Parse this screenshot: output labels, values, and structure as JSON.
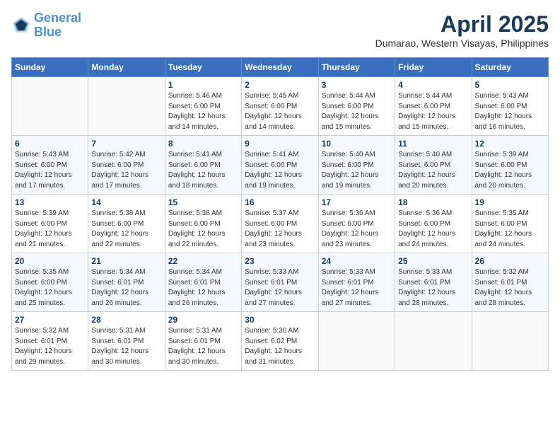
{
  "header": {
    "logo_line1": "General",
    "logo_line2": "Blue",
    "month": "April 2025",
    "location": "Dumarao, Western Visayas, Philippines"
  },
  "weekdays": [
    "Sunday",
    "Monday",
    "Tuesday",
    "Wednesday",
    "Thursday",
    "Friday",
    "Saturday"
  ],
  "weeks": [
    [
      {
        "day": "",
        "info": ""
      },
      {
        "day": "",
        "info": ""
      },
      {
        "day": "1",
        "info": "Sunrise: 5:46 AM\nSunset: 6:00 PM\nDaylight: 12 hours\nand 14 minutes."
      },
      {
        "day": "2",
        "info": "Sunrise: 5:45 AM\nSunset: 6:00 PM\nDaylight: 12 hours\nand 14 minutes."
      },
      {
        "day": "3",
        "info": "Sunrise: 5:44 AM\nSunset: 6:00 PM\nDaylight: 12 hours\nand 15 minutes."
      },
      {
        "day": "4",
        "info": "Sunrise: 5:44 AM\nSunset: 6:00 PM\nDaylight: 12 hours\nand 15 minutes."
      },
      {
        "day": "5",
        "info": "Sunrise: 5:43 AM\nSunset: 6:00 PM\nDaylight: 12 hours\nand 16 minutes."
      }
    ],
    [
      {
        "day": "6",
        "info": "Sunrise: 5:43 AM\nSunset: 6:00 PM\nDaylight: 12 hours\nand 17 minutes."
      },
      {
        "day": "7",
        "info": "Sunrise: 5:42 AM\nSunset: 6:00 PM\nDaylight: 12 hours\nand 17 minutes."
      },
      {
        "day": "8",
        "info": "Sunrise: 5:41 AM\nSunset: 6:00 PM\nDaylight: 12 hours\nand 18 minutes."
      },
      {
        "day": "9",
        "info": "Sunrise: 5:41 AM\nSunset: 6:00 PM\nDaylight: 12 hours\nand 19 minutes."
      },
      {
        "day": "10",
        "info": "Sunrise: 5:40 AM\nSunset: 6:00 PM\nDaylight: 12 hours\nand 19 minutes."
      },
      {
        "day": "11",
        "info": "Sunrise: 5:40 AM\nSunset: 6:00 PM\nDaylight: 12 hours\nand 20 minutes."
      },
      {
        "day": "12",
        "info": "Sunrise: 5:39 AM\nSunset: 6:00 PM\nDaylight: 12 hours\nand 20 minutes."
      }
    ],
    [
      {
        "day": "13",
        "info": "Sunrise: 5:39 AM\nSunset: 6:00 PM\nDaylight: 12 hours\nand 21 minutes."
      },
      {
        "day": "14",
        "info": "Sunrise: 5:38 AM\nSunset: 6:00 PM\nDaylight: 12 hours\nand 22 minutes."
      },
      {
        "day": "15",
        "info": "Sunrise: 5:38 AM\nSunset: 6:00 PM\nDaylight: 12 hours\nand 22 minutes."
      },
      {
        "day": "16",
        "info": "Sunrise: 5:37 AM\nSunset: 6:00 PM\nDaylight: 12 hours\nand 23 minutes."
      },
      {
        "day": "17",
        "info": "Sunrise: 5:36 AM\nSunset: 6:00 PM\nDaylight: 12 hours\nand 23 minutes."
      },
      {
        "day": "18",
        "info": "Sunrise: 5:36 AM\nSunset: 6:00 PM\nDaylight: 12 hours\nand 24 minutes."
      },
      {
        "day": "19",
        "info": "Sunrise: 5:35 AM\nSunset: 6:00 PM\nDaylight: 12 hours\nand 24 minutes."
      }
    ],
    [
      {
        "day": "20",
        "info": "Sunrise: 5:35 AM\nSunset: 6:00 PM\nDaylight: 12 hours\nand 25 minutes."
      },
      {
        "day": "21",
        "info": "Sunrise: 5:34 AM\nSunset: 6:01 PM\nDaylight: 12 hours\nand 26 minutes."
      },
      {
        "day": "22",
        "info": "Sunrise: 5:34 AM\nSunset: 6:01 PM\nDaylight: 12 hours\nand 26 minutes."
      },
      {
        "day": "23",
        "info": "Sunrise: 5:33 AM\nSunset: 6:01 PM\nDaylight: 12 hours\nand 27 minutes."
      },
      {
        "day": "24",
        "info": "Sunrise: 5:33 AM\nSunset: 6:01 PM\nDaylight: 12 hours\nand 27 minutes."
      },
      {
        "day": "25",
        "info": "Sunrise: 5:33 AM\nSunset: 6:01 PM\nDaylight: 12 hours\nand 28 minutes."
      },
      {
        "day": "26",
        "info": "Sunrise: 5:32 AM\nSunset: 6:01 PM\nDaylight: 12 hours\nand 28 minutes."
      }
    ],
    [
      {
        "day": "27",
        "info": "Sunrise: 5:32 AM\nSunset: 6:01 PM\nDaylight: 12 hours\nand 29 minutes."
      },
      {
        "day": "28",
        "info": "Sunrise: 5:31 AM\nSunset: 6:01 PM\nDaylight: 12 hours\nand 30 minutes."
      },
      {
        "day": "29",
        "info": "Sunrise: 5:31 AM\nSunset: 6:01 PM\nDaylight: 12 hours\nand 30 minutes."
      },
      {
        "day": "30",
        "info": "Sunrise: 5:30 AM\nSunset: 6:02 PM\nDaylight: 12 hours\nand 31 minutes."
      },
      {
        "day": "",
        "info": ""
      },
      {
        "day": "",
        "info": ""
      },
      {
        "day": "",
        "info": ""
      }
    ]
  ]
}
